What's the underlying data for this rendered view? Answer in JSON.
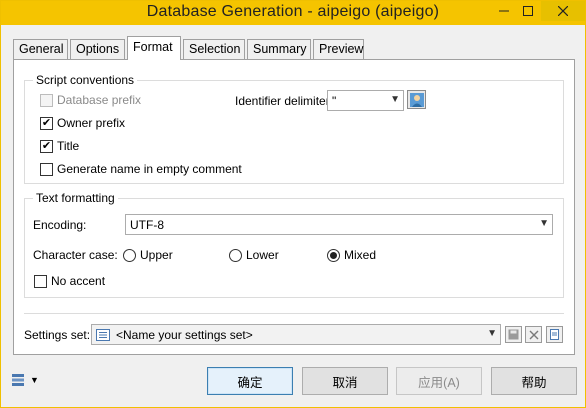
{
  "window": {
    "title": "Database Generation - aipeigo (aipeigo)"
  },
  "tabs": [
    {
      "label": "General"
    },
    {
      "label": "Options"
    },
    {
      "label": "Format",
      "active": true
    },
    {
      "label": "Selection"
    },
    {
      "label": "Summary"
    },
    {
      "label": "Preview"
    }
  ],
  "script_conventions": {
    "legend": "Script conventions",
    "database_prefix": {
      "label": "Database prefix",
      "checked": false,
      "disabled": true
    },
    "owner_prefix": {
      "label": "Owner prefix",
      "checked": true
    },
    "title": {
      "label": "Title",
      "checked": true
    },
    "generate_name": {
      "label": "Generate name in empty comment",
      "checked": false
    },
    "identifier_delimiter": {
      "label": "Identifier delimiter:",
      "value": "\""
    }
  },
  "text_formatting": {
    "legend": "Text formatting",
    "encoding": {
      "label": "Encoding:",
      "value": "UTF-8"
    },
    "character_case": {
      "label": "Character case:",
      "options": [
        {
          "label": "Upper",
          "selected": false
        },
        {
          "label": "Lower",
          "selected": false
        },
        {
          "label": "Mixed",
          "selected": true
        }
      ]
    },
    "no_accent": {
      "label": "No accent",
      "checked": false
    }
  },
  "settings_set": {
    "label": "Settings set:",
    "value": "<Name your settings set>"
  },
  "buttons": {
    "ok": "确定",
    "cancel": "取消",
    "apply": "应用(A)",
    "help": "帮助"
  },
  "colors": {
    "titlebar": "#f5c400",
    "primary_border": "#3c7fb1"
  }
}
